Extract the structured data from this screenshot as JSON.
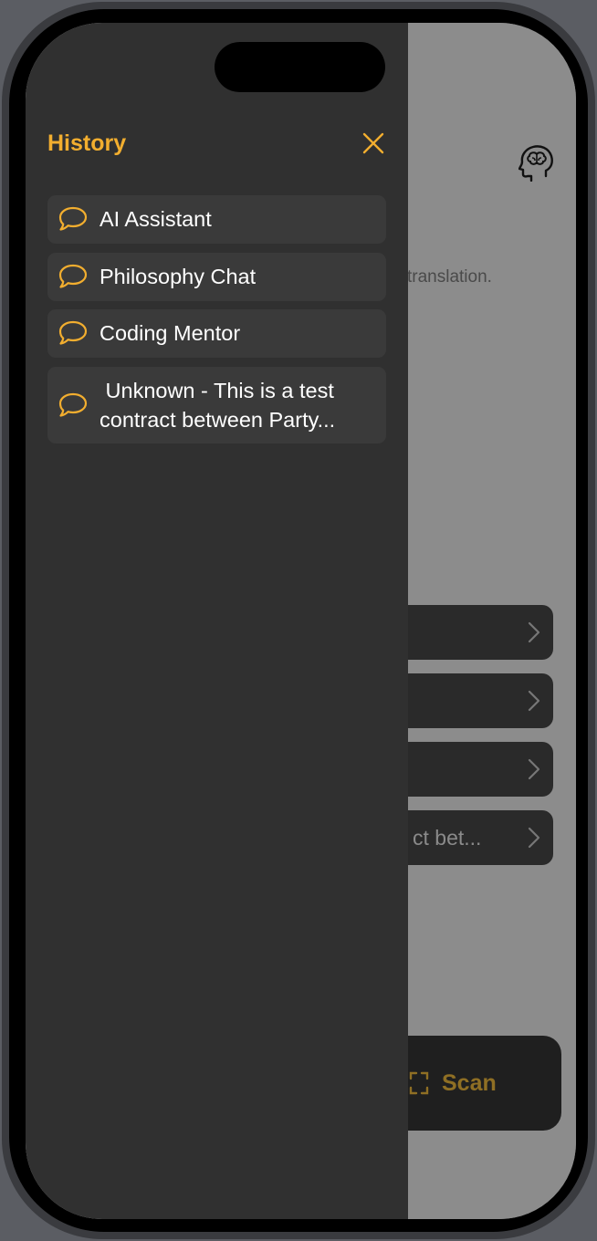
{
  "history": {
    "title": "History",
    "close_icon": "close-icon",
    "items": [
      {
        "label": "AI Assistant",
        "icon": "chat-bubble-icon"
      },
      {
        "label": "Philosophy Chat",
        "icon": "chat-bubble-icon"
      },
      {
        "label": "Coding Mentor",
        "icon": "chat-bubble-icon"
      },
      {
        "label": " Unknown - This is a test contract between Party...",
        "icon": "chat-bubble-icon"
      }
    ]
  },
  "background": {
    "subtitle_fragment": "translation.",
    "row_4_fragment": "ct bet...",
    "scan_label": "Scan"
  },
  "colors": {
    "accent": "#f2ae2f",
    "drawer_bg": "#303030",
    "item_bg": "#3a3a3a"
  }
}
